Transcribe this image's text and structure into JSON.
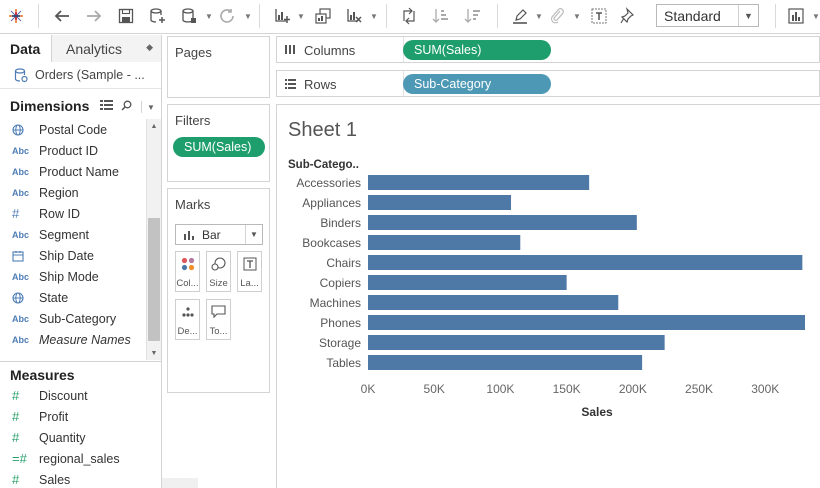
{
  "toolbar": {
    "view_mode": "Standard",
    "icons": [
      "tableau-logo-icon",
      "undo-icon",
      "redo-icon",
      "save-icon",
      "new-datasource-icon",
      "datasource-icon",
      "refresh-icon",
      "new-worksheet-icon",
      "duplicate-sheet-icon",
      "clear-sheet-icon",
      "swap-icon",
      "sort-ascending-icon",
      "sort-descending-icon",
      "highlight-icon",
      "group-icon",
      "label-icon",
      "pin-icon",
      "show-me-icon"
    ]
  },
  "datapane": {
    "tab_data": "Data",
    "tab_analytics": "Analytics",
    "datasource": "Orders (Sample - ...",
    "dimensions_title": "Dimensions",
    "dimensions": [
      {
        "type": "geo",
        "icon": "globe-icon",
        "name": "Postal Code",
        "italic": false
      },
      {
        "type": "text",
        "icon": "Abc",
        "name": "Product ID",
        "italic": false
      },
      {
        "type": "text",
        "icon": "Abc",
        "name": "Product Name",
        "italic": false
      },
      {
        "type": "text",
        "icon": "Abc",
        "name": "Region",
        "italic": false
      },
      {
        "type": "number",
        "icon": "#",
        "name": "Row ID",
        "italic": false
      },
      {
        "type": "text",
        "icon": "Abc",
        "name": "Segment",
        "italic": false
      },
      {
        "type": "date",
        "icon": "calendar-icon",
        "name": "Ship Date",
        "italic": false
      },
      {
        "type": "text",
        "icon": "Abc",
        "name": "Ship Mode",
        "italic": false
      },
      {
        "type": "geo",
        "icon": "globe-icon",
        "name": "State",
        "italic": false
      },
      {
        "type": "text",
        "icon": "Abc",
        "name": "Sub-Category",
        "italic": false
      },
      {
        "type": "text",
        "icon": "Abc",
        "name": "Measure Names",
        "italic": true
      }
    ],
    "measures_title": "Measures",
    "measures": [
      {
        "icon": "#",
        "name": "Discount"
      },
      {
        "icon": "#",
        "name": "Profit"
      },
      {
        "icon": "#",
        "name": "Quantity"
      },
      {
        "icon": "=#",
        "name": "regional_sales"
      },
      {
        "icon": "#",
        "name": "Sales"
      }
    ]
  },
  "cards": {
    "pages": "Pages",
    "filters": "Filters",
    "filter_pill": "SUM(Sales)",
    "marks": "Marks",
    "mark_type": "Bar",
    "mark_buttons": [
      {
        "icon": "color-icon",
        "label": "Col..."
      },
      {
        "icon": "size-icon",
        "label": "Size"
      },
      {
        "icon": "label-icon",
        "label": "La..."
      },
      {
        "icon": "detail-icon",
        "label": "De..."
      },
      {
        "icon": "tooltip-icon",
        "label": "To..."
      }
    ]
  },
  "shelves": {
    "columns_label": "Columns",
    "columns_pill": "SUM(Sales)",
    "rows_label": "Rows",
    "rows_pill": "Sub-Category"
  },
  "sheet": {
    "title": "Sheet 1"
  },
  "chart_data": {
    "type": "bar",
    "orientation": "horizontal",
    "row_header": "Sub-Catego..",
    "categories": [
      "Accessories",
      "Appliances",
      "Binders",
      "Bookcases",
      "Chairs",
      "Copiers",
      "Machines",
      "Phones",
      "Storage",
      "Tables"
    ],
    "values": [
      167000,
      108000,
      203000,
      115000,
      328000,
      150000,
      189000,
      330000,
      224000,
      207000
    ],
    "xlabel": "Sales",
    "xticks": [
      0,
      50000,
      100000,
      150000,
      200000,
      250000,
      300000
    ],
    "xtick_labels": [
      "0K",
      "50K",
      "100K",
      "150K",
      "200K",
      "250K",
      "300K"
    ],
    "xlim": [
      0,
      330000
    ],
    "bar_color": "#4e79a7",
    "grid": false
  }
}
